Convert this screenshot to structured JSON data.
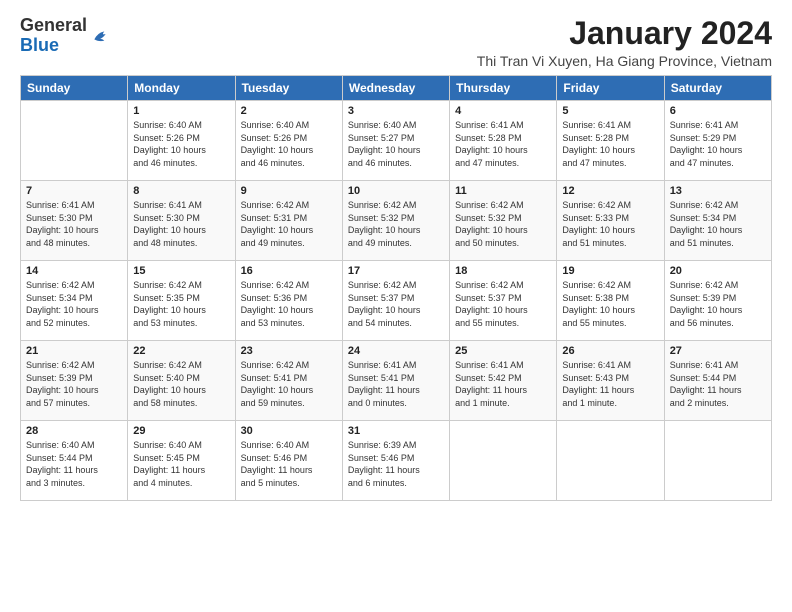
{
  "header": {
    "logo_general": "General",
    "logo_blue": "Blue",
    "month_title": "January 2024",
    "location": "Thi Tran Vi Xuyen, Ha Giang Province, Vietnam"
  },
  "days_of_week": [
    "Sunday",
    "Monday",
    "Tuesday",
    "Wednesday",
    "Thursday",
    "Friday",
    "Saturday"
  ],
  "weeks": [
    [
      {
        "day": "",
        "info": ""
      },
      {
        "day": "1",
        "info": "Sunrise: 6:40 AM\nSunset: 5:26 PM\nDaylight: 10 hours\nand 46 minutes."
      },
      {
        "day": "2",
        "info": "Sunrise: 6:40 AM\nSunset: 5:26 PM\nDaylight: 10 hours\nand 46 minutes."
      },
      {
        "day": "3",
        "info": "Sunrise: 6:40 AM\nSunset: 5:27 PM\nDaylight: 10 hours\nand 46 minutes."
      },
      {
        "day": "4",
        "info": "Sunrise: 6:41 AM\nSunset: 5:28 PM\nDaylight: 10 hours\nand 47 minutes."
      },
      {
        "day": "5",
        "info": "Sunrise: 6:41 AM\nSunset: 5:28 PM\nDaylight: 10 hours\nand 47 minutes."
      },
      {
        "day": "6",
        "info": "Sunrise: 6:41 AM\nSunset: 5:29 PM\nDaylight: 10 hours\nand 47 minutes."
      }
    ],
    [
      {
        "day": "7",
        "info": "Sunrise: 6:41 AM\nSunset: 5:30 PM\nDaylight: 10 hours\nand 48 minutes."
      },
      {
        "day": "8",
        "info": "Sunrise: 6:41 AM\nSunset: 5:30 PM\nDaylight: 10 hours\nand 48 minutes."
      },
      {
        "day": "9",
        "info": "Sunrise: 6:42 AM\nSunset: 5:31 PM\nDaylight: 10 hours\nand 49 minutes."
      },
      {
        "day": "10",
        "info": "Sunrise: 6:42 AM\nSunset: 5:32 PM\nDaylight: 10 hours\nand 49 minutes."
      },
      {
        "day": "11",
        "info": "Sunrise: 6:42 AM\nSunset: 5:32 PM\nDaylight: 10 hours\nand 50 minutes."
      },
      {
        "day": "12",
        "info": "Sunrise: 6:42 AM\nSunset: 5:33 PM\nDaylight: 10 hours\nand 51 minutes."
      },
      {
        "day": "13",
        "info": "Sunrise: 6:42 AM\nSunset: 5:34 PM\nDaylight: 10 hours\nand 51 minutes."
      }
    ],
    [
      {
        "day": "14",
        "info": "Sunrise: 6:42 AM\nSunset: 5:34 PM\nDaylight: 10 hours\nand 52 minutes."
      },
      {
        "day": "15",
        "info": "Sunrise: 6:42 AM\nSunset: 5:35 PM\nDaylight: 10 hours\nand 53 minutes."
      },
      {
        "day": "16",
        "info": "Sunrise: 6:42 AM\nSunset: 5:36 PM\nDaylight: 10 hours\nand 53 minutes."
      },
      {
        "day": "17",
        "info": "Sunrise: 6:42 AM\nSunset: 5:37 PM\nDaylight: 10 hours\nand 54 minutes."
      },
      {
        "day": "18",
        "info": "Sunrise: 6:42 AM\nSunset: 5:37 PM\nDaylight: 10 hours\nand 55 minutes."
      },
      {
        "day": "19",
        "info": "Sunrise: 6:42 AM\nSunset: 5:38 PM\nDaylight: 10 hours\nand 55 minutes."
      },
      {
        "day": "20",
        "info": "Sunrise: 6:42 AM\nSunset: 5:39 PM\nDaylight: 10 hours\nand 56 minutes."
      }
    ],
    [
      {
        "day": "21",
        "info": "Sunrise: 6:42 AM\nSunset: 5:39 PM\nDaylight: 10 hours\nand 57 minutes."
      },
      {
        "day": "22",
        "info": "Sunrise: 6:42 AM\nSunset: 5:40 PM\nDaylight: 10 hours\nand 58 minutes."
      },
      {
        "day": "23",
        "info": "Sunrise: 6:42 AM\nSunset: 5:41 PM\nDaylight: 10 hours\nand 59 minutes."
      },
      {
        "day": "24",
        "info": "Sunrise: 6:41 AM\nSunset: 5:41 PM\nDaylight: 11 hours\nand 0 minutes."
      },
      {
        "day": "25",
        "info": "Sunrise: 6:41 AM\nSunset: 5:42 PM\nDaylight: 11 hours\nand 1 minute."
      },
      {
        "day": "26",
        "info": "Sunrise: 6:41 AM\nSunset: 5:43 PM\nDaylight: 11 hours\nand 1 minute."
      },
      {
        "day": "27",
        "info": "Sunrise: 6:41 AM\nSunset: 5:44 PM\nDaylight: 11 hours\nand 2 minutes."
      }
    ],
    [
      {
        "day": "28",
        "info": "Sunrise: 6:40 AM\nSunset: 5:44 PM\nDaylight: 11 hours\nand 3 minutes."
      },
      {
        "day": "29",
        "info": "Sunrise: 6:40 AM\nSunset: 5:45 PM\nDaylight: 11 hours\nand 4 minutes."
      },
      {
        "day": "30",
        "info": "Sunrise: 6:40 AM\nSunset: 5:46 PM\nDaylight: 11 hours\nand 5 minutes."
      },
      {
        "day": "31",
        "info": "Sunrise: 6:39 AM\nSunset: 5:46 PM\nDaylight: 11 hours\nand 6 minutes."
      },
      {
        "day": "",
        "info": ""
      },
      {
        "day": "",
        "info": ""
      },
      {
        "day": "",
        "info": ""
      }
    ]
  ]
}
